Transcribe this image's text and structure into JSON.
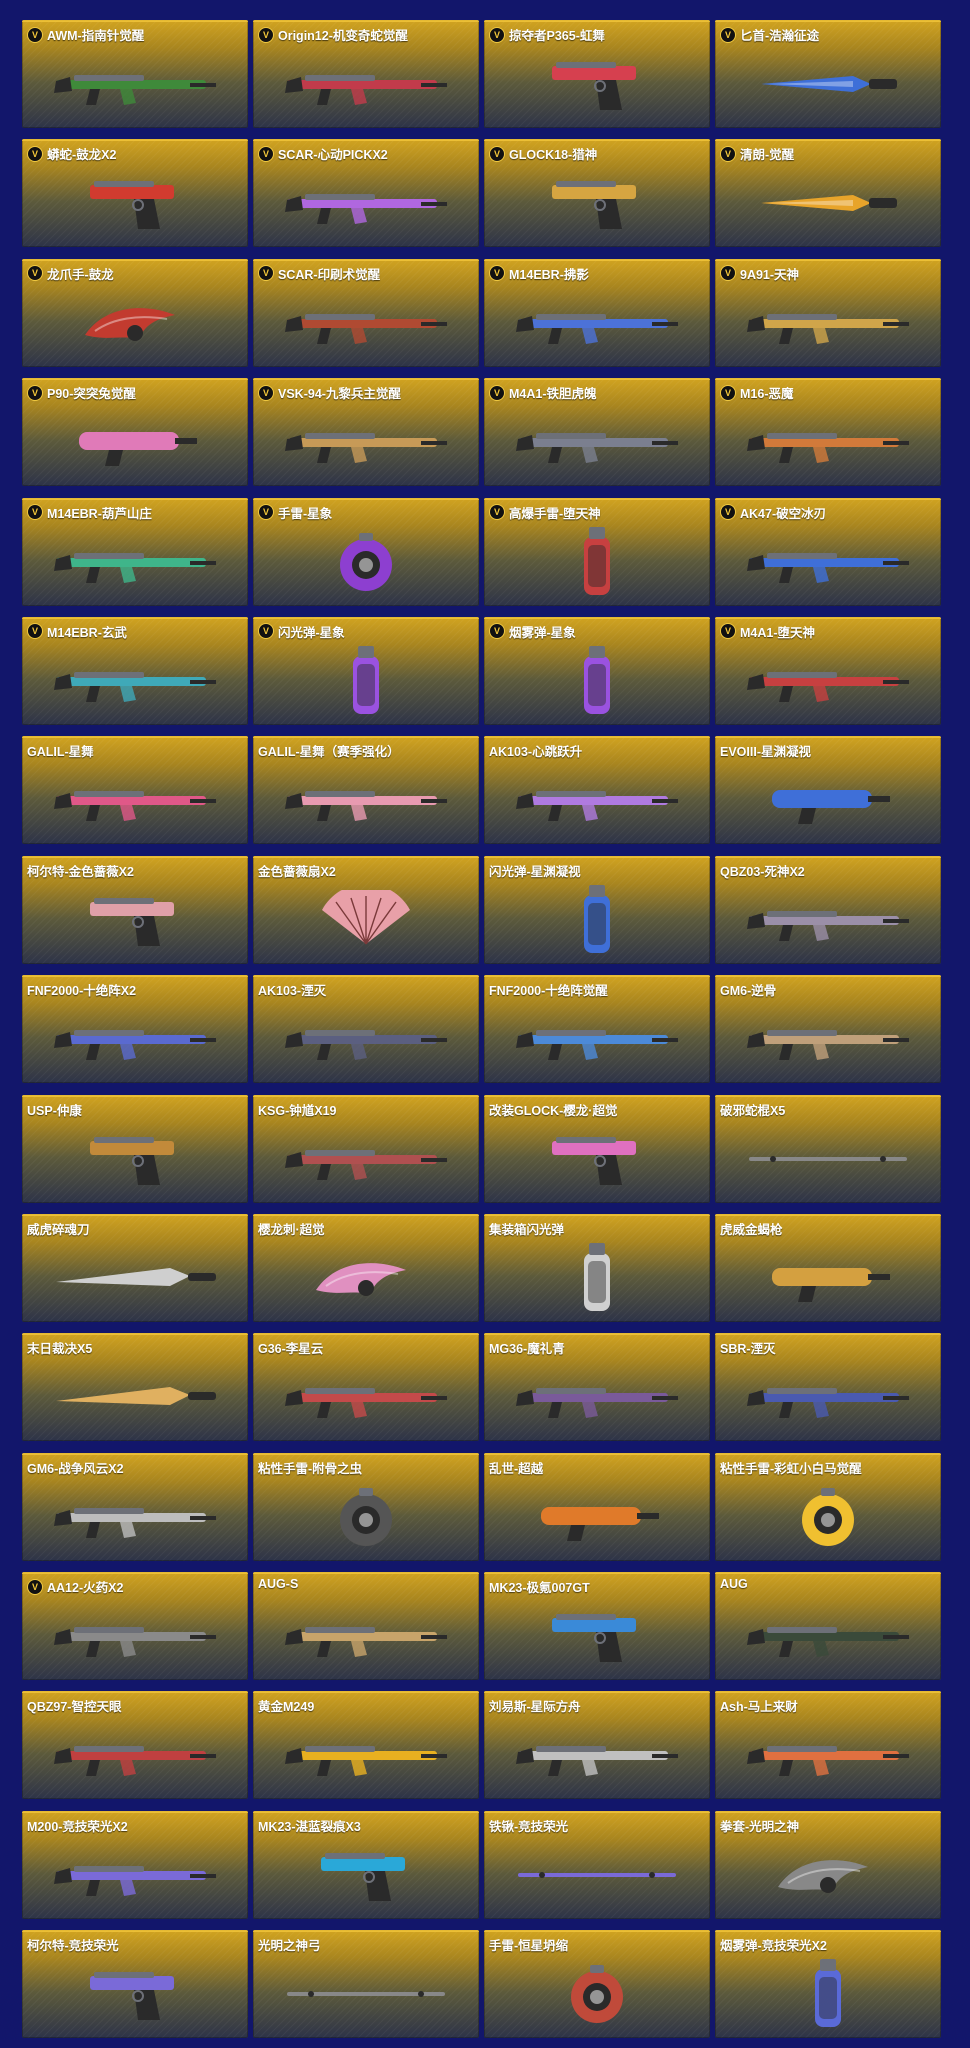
{
  "items": [
    {
      "name": "AWM-指南针觉醒",
      "v": true,
      "kind": "rifle",
      "accent": "#3f8a3a"
    },
    {
      "name": "Origin12-机变奇蛇觉醒",
      "v": true,
      "kind": "rifle",
      "accent": "#c23b4b"
    },
    {
      "name": "掠夺者P365-虹舞",
      "v": true,
      "kind": "pistol",
      "accent": "#d6404f"
    },
    {
      "name": "匕首-浩瀚征途",
      "v": true,
      "kind": "knife",
      "accent": "#3e6fd8"
    },
    {
      "name": "蟒蛇-鼓龙X2",
      "v": true,
      "kind": "pistol",
      "accent": "#d13b2f"
    },
    {
      "name": "SCAR-心动PICKX2",
      "v": true,
      "kind": "rifle",
      "accent": "#b067e0"
    },
    {
      "name": "GLOCK18-猎神",
      "v": true,
      "kind": "pistol",
      "accent": "#d6a541"
    },
    {
      "name": "清朗-觉醒",
      "v": true,
      "kind": "knife",
      "accent": "#e8a42a"
    },
    {
      "name": "龙爪手-鼓龙",
      "v": true,
      "kind": "claw",
      "accent": "#c23b2f"
    },
    {
      "name": "SCAR-印刷术觉醒",
      "v": true,
      "kind": "rifle",
      "accent": "#b04a32"
    },
    {
      "name": "M14EBR-拂影",
      "v": true,
      "kind": "rifle",
      "accent": "#4c72d8"
    },
    {
      "name": "9A91-天神",
      "v": true,
      "kind": "rifle",
      "accent": "#d0a54a"
    },
    {
      "name": "P90-突突兔觉醒",
      "v": true,
      "kind": "smg",
      "accent": "#e07ab8"
    },
    {
      "name": "VSK-94-九黎兵主觉醒",
      "v": true,
      "kind": "rifle",
      "accent": "#c79a57"
    },
    {
      "name": "M4A1-铁胆虎魄",
      "v": true,
      "kind": "rifle",
      "accent": "#7b7f8f"
    },
    {
      "name": "M16-恶魔",
      "v": true,
      "kind": "rifle",
      "accent": "#d27a3a"
    },
    {
      "name": "M14EBR-葫芦山庄",
      "v": true,
      "kind": "rifle",
      "accent": "#3fb58a"
    },
    {
      "name": "手雷-星象",
      "v": true,
      "kind": "round",
      "accent": "#8d3fd0"
    },
    {
      "name": "高爆手雷-堕天神",
      "v": true,
      "kind": "canister",
      "accent": "#c74040"
    },
    {
      "name": "AK47-破空冰刃",
      "v": true,
      "kind": "rifle",
      "accent": "#3f6fd8"
    },
    {
      "name": "M14EBR-玄武",
      "v": true,
      "kind": "rifle",
      "accent": "#3fa9b8"
    },
    {
      "name": "闪光弹-星象",
      "v": true,
      "kind": "canister",
      "accent": "#9a52e0"
    },
    {
      "name": "烟雾弹-星象",
      "v": true,
      "kind": "canister",
      "accent": "#9a52e0"
    },
    {
      "name": "M4A1-堕天神",
      "v": true,
      "kind": "rifle",
      "accent": "#c74040"
    },
    {
      "name": "GALIL-星舞",
      "v": false,
      "kind": "rifle",
      "accent": "#e05888"
    },
    {
      "name": "GALIL-星舞（赛季强化）",
      "v": false,
      "kind": "rifle",
      "accent": "#e89ab0"
    },
    {
      "name": "AK103-心跳跃升",
      "v": false,
      "kind": "rifle",
      "accent": "#b07ae0"
    },
    {
      "name": "EVOIII-星渊凝视",
      "v": false,
      "kind": "smg",
      "accent": "#3f6fd8"
    },
    {
      "name": "柯尔特-金色蔷薇X2",
      "v": false,
      "kind": "pistol",
      "accent": "#e0a0a8"
    },
    {
      "name": "金色蔷薇扇X2",
      "v": false,
      "kind": "fan",
      "accent": "#e8a0a8"
    },
    {
      "name": "闪光弹-星渊凝视",
      "v": false,
      "kind": "canister",
      "accent": "#3f6fd8"
    },
    {
      "name": "QBZ03-死神X2",
      "v": false,
      "kind": "rifle",
      "accent": "#9b8fa8"
    },
    {
      "name": "FNF2000-十绝阵X2",
      "v": false,
      "kind": "rifle",
      "accent": "#5a6ad0"
    },
    {
      "name": "AK103-湮灭",
      "v": false,
      "kind": "rifle",
      "accent": "#5b5f80"
    },
    {
      "name": "FNF2000-十绝阵觉醒",
      "v": false,
      "kind": "rifle",
      "accent": "#4c8ad8"
    },
    {
      "name": "GM6-逆骨",
      "v": false,
      "kind": "rifle",
      "accent": "#c0a07a"
    },
    {
      "name": "USP-仲康",
      "v": false,
      "kind": "pistol",
      "accent": "#c28a3a"
    },
    {
      "name": "KSG-钟馗X19",
      "v": false,
      "kind": "rifle",
      "accent": "#b05050"
    },
    {
      "name": "改装GLOCK-樱龙·超觉",
      "v": false,
      "kind": "pistol",
      "accent": "#e070c0"
    },
    {
      "name": "破邪蛇棍X5",
      "v": false,
      "kind": "staff",
      "accent": "#888888"
    },
    {
      "name": "威虎碎魂刀",
      "v": false,
      "kind": "blade",
      "accent": "#cfcfcf"
    },
    {
      "name": "樱龙刺·超觉",
      "v": false,
      "kind": "claw",
      "accent": "#e090c0"
    },
    {
      "name": "集装箱闪光弹",
      "v": false,
      "kind": "canister",
      "accent": "#d0d0d0"
    },
    {
      "name": "虎威金蝎枪",
      "v": false,
      "kind": "smg",
      "accent": "#d4a040"
    },
    {
      "name": "末日裁决X5",
      "v": false,
      "kind": "blade",
      "accent": "#e0b060"
    },
    {
      "name": "G36-李星云",
      "v": false,
      "kind": "rifle",
      "accent": "#c44a4a"
    },
    {
      "name": "MG36-魔礼青",
      "v": false,
      "kind": "rifle",
      "accent": "#7a5a9a"
    },
    {
      "name": "SBR-湮灭",
      "v": false,
      "kind": "rifle",
      "accent": "#4a5ab0"
    },
    {
      "name": "GM6-战争风云X2",
      "v": false,
      "kind": "rifle",
      "accent": "#bdbdbd"
    },
    {
      "name": "粘性手雷-附骨之虫",
      "v": false,
      "kind": "round",
      "accent": "#555555"
    },
    {
      "name": "乱世-超越",
      "v": false,
      "kind": "smg",
      "accent": "#e07a2a"
    },
    {
      "name": "粘性手雷-彩虹小白马觉醒",
      "v": false,
      "kind": "round",
      "accent": "#f0c030"
    },
    {
      "name": "AA12-火药X2",
      "v": true,
      "kind": "rifle",
      "accent": "#8a8a8a"
    },
    {
      "name": "AUG-S",
      "v": false,
      "kind": "rifle",
      "accent": "#c8a46a"
    },
    {
      "name": "MK23-极氪007GT",
      "v": false,
      "kind": "pistol",
      "accent": "#3a8ad8"
    },
    {
      "name": "AUG",
      "v": false,
      "kind": "rifle",
      "accent": "#3a4a3a"
    },
    {
      "name": "QBZ97-智控天眼",
      "v": false,
      "kind": "rifle",
      "accent": "#c04040"
    },
    {
      "name": "黄金M249",
      "v": false,
      "kind": "rifle",
      "accent": "#e8b020"
    },
    {
      "name": "刘易斯-星际方舟",
      "v": false,
      "kind": "rifle",
      "accent": "#c0c0c0"
    },
    {
      "name": "Ash-马上来财",
      "v": false,
      "kind": "rifle",
      "accent": "#e07040"
    },
    {
      "name": "M200-竞技荣光X2",
      "v": false,
      "kind": "rifle",
      "accent": "#7a6ad8"
    },
    {
      "name": "MK23-湛蓝裂痕X3",
      "v": false,
      "kind": "pistol",
      "accent": "#2aa8d8"
    },
    {
      "name": "铁锹-竞技荣光",
      "v": false,
      "kind": "staff",
      "accent": "#7a6ad8"
    },
    {
      "name": "拳套-光明之神",
      "v": false,
      "kind": "claw",
      "accent": "#888888"
    },
    {
      "name": "柯尔特-竞技荣光",
      "v": false,
      "kind": "pistol",
      "accent": "#7a6ad8"
    },
    {
      "name": "光明之神弓",
      "v": false,
      "kind": "staff",
      "accent": "#888888"
    },
    {
      "name": "手雷-恒星坍缩",
      "v": false,
      "kind": "round",
      "accent": "#c04a3a"
    },
    {
      "name": "烟雾弹-竞技荣光X2",
      "v": false,
      "kind": "canister",
      "accent": "#5a6ad8"
    }
  ],
  "badge_text": "V"
}
